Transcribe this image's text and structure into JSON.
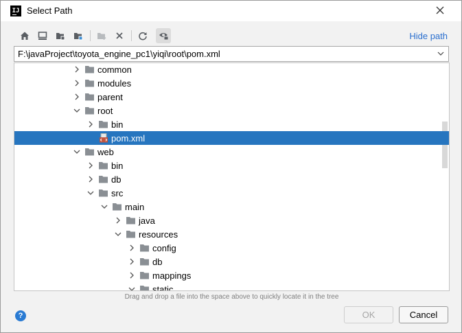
{
  "window": {
    "title": "Select Path"
  },
  "toolbar": {
    "buttons": [
      {
        "icon": "home-icon"
      },
      {
        "icon": "desktop-icon"
      },
      {
        "icon": "project-folder-icon"
      },
      {
        "icon": "module-folder-icon"
      },
      {
        "icon": "new-folder-icon"
      },
      {
        "icon": "delete-icon"
      },
      {
        "icon": "refresh-icon"
      },
      {
        "icon": "show-hidden-icon"
      }
    ],
    "hide_path_label": "Hide path"
  },
  "path_field": {
    "value": "F:\\javaProject\\toyota_engine_pc1\\yiqi\\root\\pom.xml"
  },
  "tree": {
    "rows": [
      {
        "label": "common",
        "expanded": false,
        "type": "folder"
      },
      {
        "label": "modules",
        "expanded": false,
        "type": "folder"
      },
      {
        "label": "parent",
        "expanded": false,
        "type": "folder"
      },
      {
        "label": "root",
        "expanded": true,
        "type": "folder"
      },
      {
        "label": "bin",
        "expanded": false,
        "type": "folder"
      },
      {
        "label": "pom.xml",
        "type": "file",
        "selected": true
      },
      {
        "label": "web",
        "expanded": true,
        "type": "folder"
      },
      {
        "label": "bin",
        "expanded": false,
        "type": "folder"
      },
      {
        "label": "db",
        "expanded": false,
        "type": "folder"
      },
      {
        "label": "src",
        "expanded": true,
        "type": "folder"
      },
      {
        "label": "main",
        "expanded": true,
        "type": "folder"
      },
      {
        "label": "java",
        "expanded": false,
        "type": "folder"
      },
      {
        "label": "resources",
        "expanded": true,
        "type": "folder"
      },
      {
        "label": "config",
        "expanded": false,
        "type": "folder"
      },
      {
        "label": "db",
        "expanded": false,
        "type": "folder"
      },
      {
        "label": "mappings",
        "expanded": false,
        "type": "folder"
      },
      {
        "label": "static",
        "expanded": true,
        "type": "folder"
      }
    ]
  },
  "hint": "Drag and drop a file into the space above to quickly locate it in the tree",
  "buttons": {
    "ok": "OK",
    "cancel": "Cancel",
    "help": "?"
  },
  "colors": {
    "selection": "#2675bf",
    "link": "#2a6fcf",
    "folder": "#8a8f94"
  }
}
